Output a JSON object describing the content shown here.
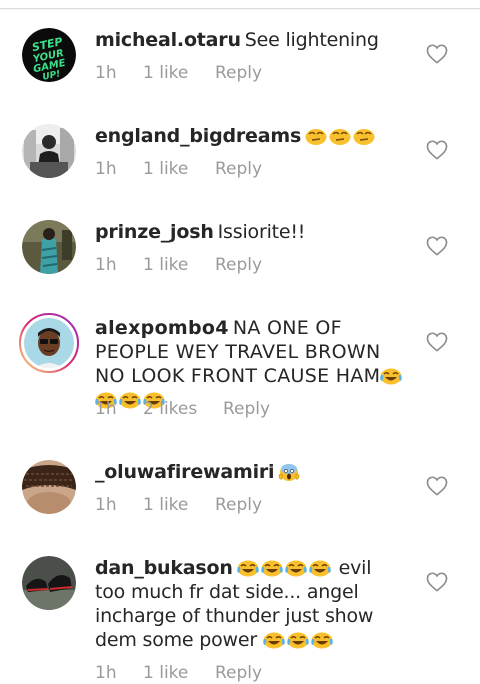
{
  "comments": [
    {
      "username": "micheal.otaru",
      "text": "See lightening",
      "emoji_suffix": "",
      "time": "1h",
      "likes": "1 like",
      "reply": "Reply",
      "avatar": "step-your-game-up-logo"
    },
    {
      "username": "england_bigdreams",
      "text": "",
      "emoji_suffix": "face-with-rolling-eyes x3",
      "time": "1h",
      "likes": "1 like",
      "reply": "Reply",
      "avatar": "person-photo"
    },
    {
      "username": "prinze_josh",
      "text": "Issiorite!!",
      "emoji_suffix": "",
      "time": "1h",
      "likes": "1 like",
      "reply": "Reply",
      "avatar": "person-photo"
    },
    {
      "username": "alexpombo4",
      "text": "NA ONE OF PEOPLE WEY TRAVEL BROWN NO LOOK FRONT CAUSE HAM",
      "emoji_suffix": "face-with-tears-of-joy x4",
      "time": "1h",
      "likes": "2 likes",
      "reply": "Reply",
      "avatar": "cartoon-avatar"
    },
    {
      "username": "_oluwafirewamiri",
      "text": "",
      "emoji_suffix": "face-screaming-in-fear",
      "time": "1h",
      "likes": "1 like",
      "reply": "Reply",
      "avatar": "hair-photo"
    },
    {
      "username": "dan_bukason",
      "text_after_emoji": "evil too much fr dat side... angel incharge of thunder just show dem some power",
      "emoji_prefix": "face-with-tears-of-joy x4",
      "emoji_suffix": "face-with-tears-of-joy x3",
      "time": "1h",
      "likes": "1 like",
      "reply": "Reply",
      "avatar": "shoes-photo"
    }
  ],
  "icons": {
    "heart": "heart-outline-icon"
  },
  "colors": {
    "text": "#262626",
    "meta": "#9a9a9a",
    "heart": "#8e8e8e",
    "avatar_ring": "#d6249f"
  }
}
